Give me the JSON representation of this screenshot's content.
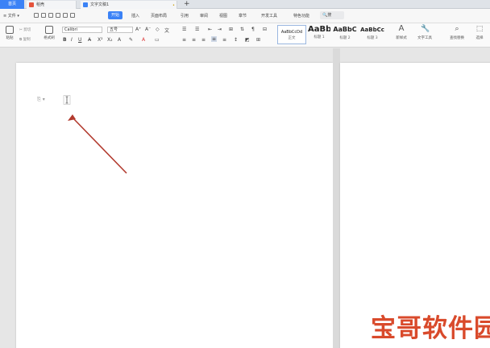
{
  "tabbar": {
    "home_tab": "首页",
    "tabs": [
      {
        "label": "稻壳",
        "icon": "daoke-icon",
        "color": "#e5533c"
      },
      {
        "label": "文字文稿1",
        "icon": "writer-doc-icon",
        "color": "#3b82f6"
      }
    ],
    "close_glyph": "•",
    "add_glyph": "+"
  },
  "menubar": {
    "file_label": "文件",
    "menus": [
      "开始",
      "插入",
      "页面布局",
      "引用",
      "审阅",
      "视图",
      "章节",
      "开发工具",
      "特色功能"
    ],
    "active_menu": "开始",
    "search_label": "搜",
    "accent": "#3b82f6"
  },
  "ribbon": {
    "paste_label": "粘贴",
    "cut_label": "剪切",
    "copy_label": "复制",
    "format_painter_label": "格式刷",
    "font_name": "Calibri",
    "font_size": "五号",
    "styles": [
      {
        "sample": "AaBbCcDd",
        "label": "正文"
      },
      {
        "sample": "AaBb",
        "label": "标题 1"
      },
      {
        "sample": "AaBbC",
        "label": "标题 2"
      },
      {
        "sample": "AaBbCc",
        "label": "标题 3"
      }
    ],
    "new_style_label": "新样式",
    "text_tools_label": "文字工具",
    "find_replace_label": "查找替换",
    "select_label": "选择"
  },
  "document": {
    "paragraph_mark": "⎘",
    "arrow_color": "#b23a2e"
  },
  "watermark": {
    "text": "宝哥软件园"
  }
}
